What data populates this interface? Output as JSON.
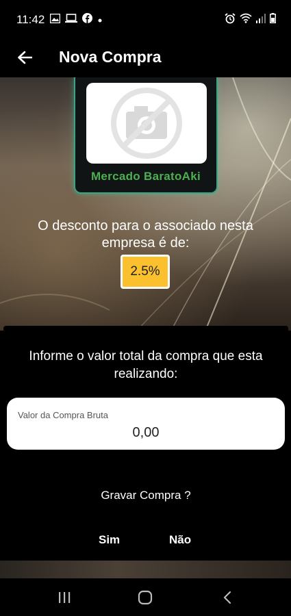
{
  "status_bar": {
    "time": "11:42",
    "left_icons": [
      "image-icon",
      "laptop-icon",
      "facebook-icon",
      "dot-icon"
    ],
    "right_icons": [
      "alarm-icon",
      "wifi-icon",
      "signal-icon",
      "battery-icon"
    ]
  },
  "app_bar": {
    "title": "Nova Compra",
    "back_icon": "arrow-left-icon"
  },
  "merchant": {
    "name": "Mercado BaratoAki",
    "logo_icon": "no-camera-icon"
  },
  "discount": {
    "text": "O desconto para o associado nesta empresa é de:",
    "value": "2.5%"
  },
  "dialog": {
    "prompt": "Informe o valor total da compra que esta realizando:",
    "field_label": "Valor da Compra Bruta",
    "field_value": "0,00",
    "question": "Gravar Compra ?",
    "yes_label": "Sim",
    "no_label": "Não"
  },
  "nav_bar": {
    "icons": [
      "recent-apps-icon",
      "home-icon",
      "back-icon"
    ]
  },
  "colors": {
    "accent_green": "#4caf50",
    "badge_yellow": "#fbc02d"
  }
}
